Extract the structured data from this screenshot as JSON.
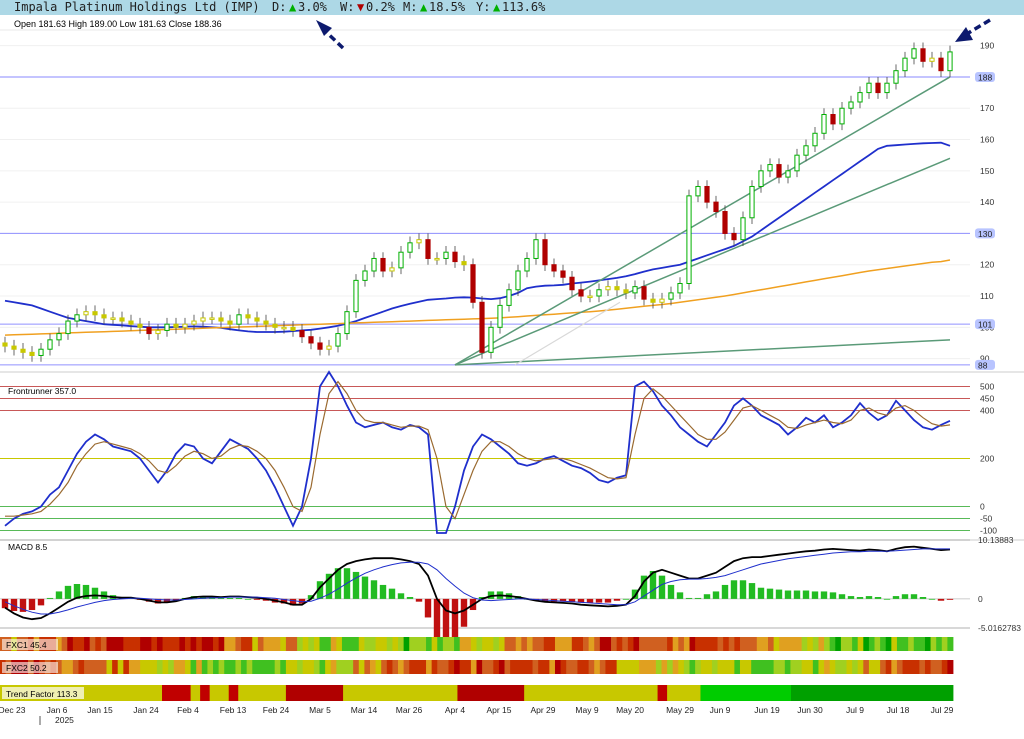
{
  "header": {
    "title": "Impala Platinum Holdings Ltd (IMP)",
    "changes": [
      {
        "label": "D:",
        "dir": "up",
        "value": "3.0%"
      },
      {
        "label": "W:",
        "dir": "down",
        "value": "0.2%"
      },
      {
        "label": "M:",
        "dir": "up",
        "value": "18.5%"
      },
      {
        "label": "Y:",
        "dir": "up",
        "value": "113.6%"
      }
    ],
    "ohlc": "Open 181.63  High 189.00  Low 181.63  Close 188.36",
    "up_arrow": "▲",
    "down_arrow": "▼"
  },
  "colors": {
    "header_bg": "#add8e6",
    "up": "#00b000",
    "down": "#b00000",
    "neutral": "#c8c800",
    "ma_blue": "#1f2fcc",
    "ma_orange": "#f0a020",
    "trend": "#5a9a78",
    "arrow": "#0d1a6e"
  },
  "price_labels": {
    "current": "188",
    "upper_line": "130",
    "mid_line": "101",
    "low_line": "88"
  },
  "chart_data": [
    {
      "type": "candlestick",
      "name": "price",
      "ylim": [
        87,
        195
      ],
      "yticks": [
        90,
        100,
        110,
        120,
        130,
        140,
        150,
        160,
        170,
        180,
        190
      ],
      "horizontal_lines": [
        180,
        130,
        101,
        88
      ],
      "x_labels": [
        "Dec 23",
        "Jan 6",
        "Jan 15",
        "Jan 24",
        "Feb 4",
        "Feb 13",
        "Feb 24",
        "Mar 5",
        "Mar 14",
        "Mar 26",
        "Apr 4",
        "Apr 15",
        "Apr 29",
        "May 9",
        "May 20",
        "May 29",
        "Jun 9",
        "Jun 19",
        "Jun 30",
        "Jul 9",
        "Jul 18",
        "Jul 29"
      ],
      "year_label": "2025",
      "close": [
        94,
        93,
        92,
        91,
        93,
        96,
        98,
        102,
        104,
        105,
        104,
        103,
        103,
        102,
        101,
        100,
        98,
        99,
        101,
        100,
        101,
        102,
        103,
        103,
        102,
        101,
        104,
        103,
        102,
        101,
        100,
        100,
        99,
        97,
        95,
        93,
        94,
        98,
        105,
        115,
        118,
        122,
        118,
        119,
        124,
        127,
        128,
        122,
        122,
        124,
        121,
        120,
        108,
        92,
        100,
        107,
        112,
        118,
        122,
        128,
        120,
        118,
        116,
        112,
        110,
        110,
        112,
        113,
        112,
        111,
        113,
        109,
        108,
        109,
        111,
        114,
        142,
        145,
        140,
        137,
        130,
        128,
        135,
        145,
        150,
        152,
        148,
        150,
        155,
        158,
        162,
        168,
        165,
        170,
        172,
        175,
        178,
        175,
        178,
        182,
        186,
        189,
        185,
        186,
        182,
        188
      ],
      "series": [
        {
          "name": "",
          "type": "line",
          "color": "#1f2fcc",
          "values": [
            108.5,
            108,
            107.5,
            107,
            106,
            105,
            104,
            103,
            102.5,
            102,
            101.5,
            101,
            100.8,
            100.6,
            100.4,
            100.2,
            100,
            100,
            100,
            100.1,
            100.2,
            100.3,
            100.2,
            100,
            99.8,
            99.4,
            99,
            98.7,
            98.5,
            98.5,
            98.5,
            98.6,
            98.8,
            99,
            99.2,
            99.6,
            100,
            100.5,
            101.2,
            102,
            103,
            104,
            105,
            106,
            106.8,
            107.5,
            108.2,
            108.8,
            109,
            109.2,
            109.5,
            109.6,
            109.5,
            109.2,
            109,
            109.3,
            110,
            111,
            112.5,
            113,
            113.3,
            113.4,
            113.6,
            114,
            114.3,
            114.6,
            115,
            115.4,
            115.8,
            116.3,
            117,
            117.8,
            118.5,
            119,
            119.5,
            120,
            121,
            122,
            123,
            124,
            125,
            126,
            127.5,
            129,
            131,
            133,
            135,
            137,
            139,
            141,
            143,
            145,
            147,
            149,
            151,
            153,
            155,
            157,
            158,
            158.2,
            158.4,
            158.6,
            158.8,
            158.9,
            159,
            158
          ]
        },
        {
          "name": "",
          "type": "line",
          "color": "#f0a020",
          "values": [
            97.5,
            97.6,
            97.7,
            97.8,
            97.9,
            98,
            98.1,
            98.2,
            98.3,
            98.4,
            98.5,
            98.6,
            98.7,
            98.8,
            98.9,
            99,
            99.1,
            99.2,
            99.3,
            99.4,
            99.5,
            99.6,
            99.7,
            99.8,
            99.9,
            100,
            100.1,
            100.2,
            100.3,
            100.4,
            100.5,
            100.6,
            100.7,
            100.8,
            100.9,
            101,
            101.1,
            101.2,
            101.3,
            101.4,
            101.5,
            101.6,
            101.7,
            101.8,
            101.9,
            102,
            102.1,
            102.2,
            102.3,
            102.4,
            102.5,
            102.6,
            102.7,
            102.8,
            102.9,
            103,
            103.2,
            103.4,
            103.6,
            103.8,
            104,
            104.2,
            104.4,
            104.6,
            104.8,
            105,
            105.2,
            105.5,
            105.8,
            106.1,
            106.4,
            106.7,
            107,
            107.3,
            107.6,
            108,
            108.4,
            108.8,
            109.2,
            109.6,
            110,
            110.5,
            111,
            111.5,
            112,
            112.5,
            113,
            113.5,
            114,
            114.5,
            115,
            115.5,
            116,
            116.5,
            117,
            117.5,
            118,
            118.4,
            118.8,
            119.2,
            119.6,
            120,
            120.4,
            120.8,
            121,
            121.5
          ]
        }
      ]
    },
    {
      "type": "line",
      "title": "Frontrunner 357.0",
      "ylim": [
        -110,
        560
      ],
      "yticks": [
        500,
        450,
        400,
        200,
        0,
        -50,
        -100
      ],
      "series": [
        {
          "name": "",
          "color": "#1f2fcc",
          "values": [
            -80,
            -50,
            -30,
            -20,
            0,
            50,
            80,
            150,
            220,
            270,
            300,
            280,
            250,
            240,
            230,
            200,
            150,
            100,
            150,
            220,
            260,
            250,
            200,
            180,
            230,
            280,
            260,
            240,
            200,
            150,
            80,
            0,
            -80,
            0,
            200,
            500,
            570,
            500,
            420,
            350,
            330,
            340,
            350,
            330,
            320,
            340,
            330,
            300,
            -110,
            -110,
            0,
            150,
            250,
            300,
            280,
            250,
            220,
            180,
            170,
            180,
            200,
            210,
            190,
            170,
            160,
            140,
            110,
            100,
            120,
            130,
            500,
            520,
            480,
            420,
            380,
            330,
            300,
            270,
            250,
            300,
            350,
            420,
            450,
            420,
            380,
            360,
            340,
            300,
            330,
            370,
            350,
            380,
            330,
            350,
            380,
            430,
            390,
            360,
            380,
            440,
            400,
            360,
            330,
            320,
            340,
            357
          ]
        },
        {
          "name": "",
          "color": "#9a6a30",
          "values": [
            -40,
            -40,
            -35,
            -30,
            -20,
            10,
            50,
            100,
            170,
            220,
            260,
            270,
            260,
            250,
            240,
            220,
            190,
            150,
            140,
            170,
            210,
            230,
            220,
            200,
            210,
            240,
            255,
            250,
            230,
            200,
            150,
            80,
            0,
            -20,
            80,
            300,
            470,
            520,
            470,
            400,
            360,
            350,
            350,
            340,
            330,
            335,
            335,
            320,
            200,
            0,
            -50,
            50,
            150,
            230,
            270,
            270,
            250,
            220,
            200,
            190,
            195,
            200,
            200,
            190,
            175,
            160,
            140,
            120,
            115,
            120,
            300,
            450,
            490,
            460,
            420,
            380,
            340,
            300,
            280,
            280,
            310,
            360,
            410,
            420,
            400,
            380,
            360,
            330,
            325,
            340,
            350,
            360,
            350,
            345,
            360,
            400,
            410,
            390,
            380,
            410,
            420,
            400,
            370,
            345,
            335,
            340
          ]
        }
      ]
    },
    {
      "type": "bar",
      "title": "MACD 8.5",
      "ylim": [
        -5.0162783,
        10.13883
      ],
      "yticks_labels": [
        "10.13883",
        "0",
        "-5.0162783"
      ],
      "yticks": [
        10.13883,
        0,
        -5.0162783
      ],
      "series": [
        {
          "name": "",
          "type": "line",
          "color": "#000000",
          "values": [
            -1.5,
            -2.5,
            -3.2,
            -3.5,
            -3.3,
            -2.5,
            -1.5,
            -0.5,
            0.2,
            0.5,
            0.6,
            0.5,
            0.3,
            0.2,
            0.2,
            0,
            -0.3,
            -0.6,
            -0.6,
            -0.4,
            0,
            0.3,
            0.4,
            0.4,
            0.3,
            0.4,
            0.4,
            0.3,
            0.2,
            0,
            -0.3,
            -0.6,
            -1,
            -1,
            0,
            2,
            3.5,
            5,
            6,
            6.5,
            6.8,
            7,
            7,
            7,
            6.8,
            6.5,
            6,
            4,
            0,
            -2,
            -2.5,
            -2,
            -1,
            0,
            0.5,
            0.6,
            0.5,
            0.3,
            0,
            -0.3,
            -0.5,
            -0.6,
            -0.7,
            -0.8,
            -1,
            -1.1,
            -1.2,
            -1.3,
            -1.2,
            -1,
            0.5,
            3,
            4.5,
            5,
            4.5,
            4,
            3.5,
            3.5,
            4,
            4.5,
            5.5,
            6.5,
            7,
            7.2,
            7.2,
            7.4,
            7.6,
            7.8,
            8,
            8.2,
            8.3,
            8.5,
            8.6,
            8.5,
            8.4,
            8.3,
            8.5,
            8.4,
            8.2,
            8.6,
            8.9,
            9,
            8.8,
            8.6,
            8.4,
            8.5
          ]
        },
        {
          "name": "",
          "type": "line",
          "color": "#1f2fcc",
          "values": [
            -0.5,
            -1.2,
            -1.8,
            -2.3,
            -2.6,
            -2.6,
            -2.3,
            -1.9,
            -1.4,
            -1,
            -0.6,
            -0.3,
            -0.1,
            0,
            0.1,
            0.1,
            0,
            -0.1,
            -0.2,
            -0.2,
            -0.1,
            0,
            0.1,
            0.2,
            0.2,
            0.3,
            0.3,
            0.3,
            0.3,
            0.2,
            0.1,
            -0.1,
            -0.3,
            -0.5,
            -0.4,
            0.1,
            0.8,
            1.7,
            2.7,
            3.6,
            4.4,
            5,
            5.5,
            5.9,
            6.2,
            6.3,
            6.3,
            6,
            5,
            3.5,
            2.2,
            1,
            0.2,
            -0.2,
            -0.3,
            -0.2,
            -0.1,
            0,
            0,
            -0.1,
            -0.2,
            -0.3,
            -0.4,
            -0.5,
            -0.6,
            -0.7,
            -0.8,
            -0.9,
            -1,
            -1,
            -0.5,
            0.5,
            1.5,
            2.5,
            3,
            3.3,
            3.4,
            3.4,
            3.5,
            3.7,
            4,
            4.5,
            5,
            5.5,
            6,
            6.3,
            6.6,
            6.9,
            7.1,
            7.3,
            7.5,
            7.7,
            7.9,
            8,
            8.1,
            8.1,
            8.2,
            8.2,
            8.2,
            8.3,
            8.4,
            8.5,
            8.6,
            8.6,
            8.6,
            8.6
          ]
        }
      ]
    },
    {
      "type": "heatmap",
      "rows": [
        {
          "label": "FXC1 45.4"
        },
        {
          "label": "FXC2 50.2"
        }
      ]
    },
    {
      "type": "heatmap",
      "rows": [
        {
          "label": "Trend Factor 113.3",
          "segments": [
            {
              "start": 0,
              "end": 0.17,
              "color": "#c8c800"
            },
            {
              "start": 0.17,
              "end": 0.2,
              "color": "#c00000"
            },
            {
              "start": 0.2,
              "end": 0.21,
              "color": "#c8c800"
            },
            {
              "start": 0.21,
              "end": 0.22,
              "color": "#c00000"
            },
            {
              "start": 0.22,
              "end": 0.24,
              "color": "#c8c800"
            },
            {
              "start": 0.24,
              "end": 0.25,
              "color": "#c00000"
            },
            {
              "start": 0.25,
              "end": 0.3,
              "color": "#c8c800"
            },
            {
              "start": 0.3,
              "end": 0.36,
              "color": "#b00000"
            },
            {
              "start": 0.36,
              "end": 0.48,
              "color": "#c8c800"
            },
            {
              "start": 0.48,
              "end": 0.55,
              "color": "#b00000"
            },
            {
              "start": 0.55,
              "end": 0.69,
              "color": "#c8c800"
            },
            {
              "start": 0.69,
              "end": 0.7,
              "color": "#c00000"
            },
            {
              "start": 0.7,
              "end": 0.735,
              "color": "#c8c800"
            },
            {
              "start": 0.735,
              "end": 0.83,
              "color": "#00cc00"
            },
            {
              "start": 0.83,
              "end": 1.0,
              "color": "#00a000"
            }
          ]
        }
      ]
    }
  ]
}
